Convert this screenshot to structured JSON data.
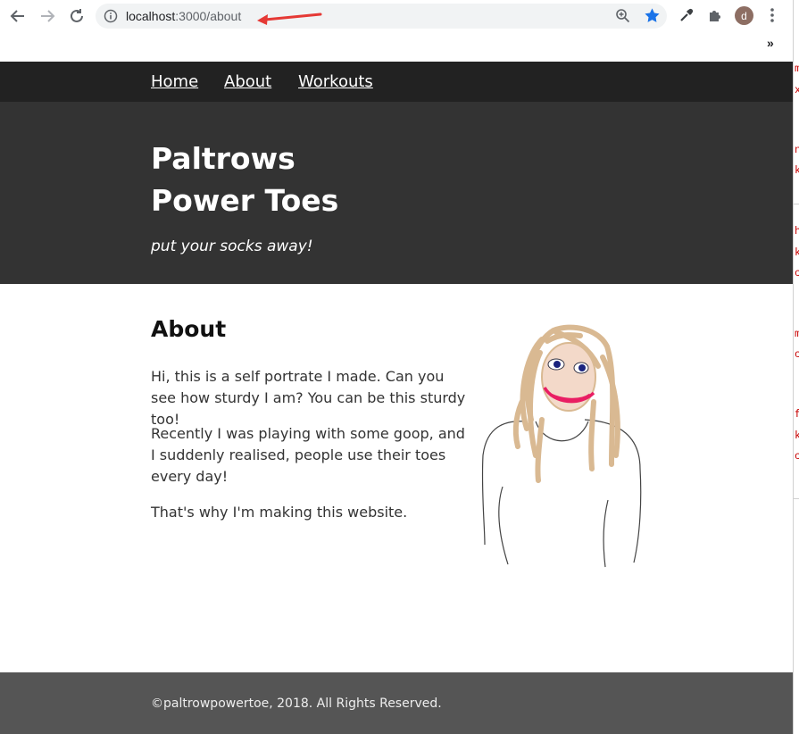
{
  "browser": {
    "url_host": "localhost",
    "url_rest": ":3000/about",
    "avatar_letter": "d",
    "overflow_label": "»"
  },
  "site": {
    "nav": [
      {
        "label": "Home"
      },
      {
        "label": "About"
      },
      {
        "label": "Workouts"
      }
    ],
    "title_line1": "Paltrows",
    "title_line2": "Power Toes",
    "tagline": "put your socks away!"
  },
  "about": {
    "heading": "About",
    "paragraphs": [
      "Hi, this is a self portrate I made. Can you see how sturdy I am? You can be this sturdy too!",
      "Recently I was playing with some goop, and I suddenly realised, people use their toes every day!",
      "That's why I'm making this website."
    ]
  },
  "footer": {
    "copyright": "©paltrowpowertoe, 2018. All Rights Reserved."
  },
  "devtools": {
    "glyphs": [
      "m",
      "x",
      "n",
      "k",
      "h",
      "k",
      "c",
      "m",
      "c",
      "f",
      "k",
      "c"
    ]
  },
  "colors": {
    "nav_bg": "#222222",
    "hero_bg": "#333333",
    "footer_bg": "#555555",
    "accent_star": "#1a73e8",
    "annotation_arrow": "#e53935"
  }
}
